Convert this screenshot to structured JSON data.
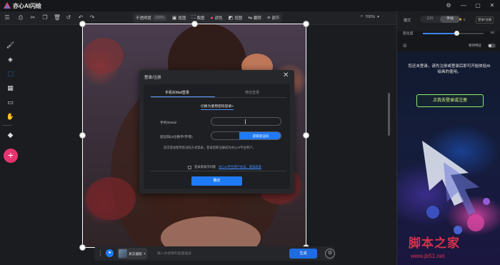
{
  "app": {
    "title": "亦心AI闪绘"
  },
  "toolbar": {
    "opacity_label": "不透明度",
    "opacity_value": "100%",
    "items": [
      {
        "label": "抠图",
        "icon": "cutout-icon"
      },
      {
        "label": "裁图",
        "icon": "crop-icon"
      },
      {
        "label": "调色",
        "icon": "color-icon"
      },
      {
        "label": "扭图",
        "icon": "warp-icon"
      },
      {
        "label": "翻转",
        "icon": "flip-icon"
      },
      {
        "label": "调节",
        "icon": "adjust-icon"
      }
    ],
    "zoom": "700%"
  },
  "modal": {
    "title": "登录/注册",
    "tab_phone": "手机/EMail登录",
    "tab_wechat": "微信登录",
    "switch_link": "切换为使用密码登录>",
    "phone_label": "手机/EMail",
    "code_label": "验证码(4位数字/字母)",
    "get_code": "获取验证码",
    "note": "首次登录使用验证码方式登录，登录后即注册成为亦心AI平台用户。",
    "agree_text": "登录即表示同意",
    "agree_link": "亦心AI平台用户协议、隐私政策",
    "confirm": "确定"
  },
  "bottombar": {
    "style_label": "真实摄影",
    "prompt_placeholder": "输入你想要的画面描述",
    "generate": "生成"
  },
  "rightpanel": {
    "mode_label": "模式",
    "seg_realtime": "实时",
    "seg_manual": "手动",
    "star_count": "0",
    "login_register": "登录/注册",
    "strength_label": "变化度",
    "strength_value": "50",
    "strength_fraction": 0.55,
    "keep_label": "保持特征",
    "promo_text": "您还未登录，请先注册或登录后即可开始体验AI绘画的使用。",
    "promo_button": "点我去登录或注册"
  },
  "watermark": {
    "text": "脚本之家",
    "url": "www.jb51.net"
  },
  "colors": {
    "accent": "#1f7af5",
    "add_button": "#e8336f",
    "promo_border": "#8cf06a"
  }
}
